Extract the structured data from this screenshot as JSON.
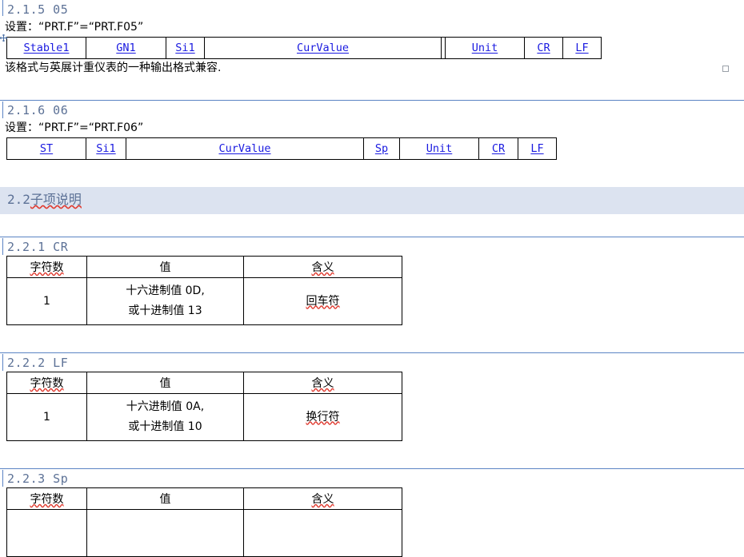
{
  "document": {
    "sections": [
      {
        "id": "2.1.5",
        "heading": "2.1.5 05",
        "setting_text": "设置：“PRT.F”=“PRT.F05”",
        "note": "该格式与英展计重仪表的一种输出格式兼容.",
        "format_fields": [
          "Stable1",
          "GN1",
          "Si1",
          "CurValue",
          "",
          "Unit",
          "CR",
          "LF"
        ]
      },
      {
        "id": "2.1.6",
        "heading": "2.1.6 06",
        "setting_text": "设置：“PRT.F”=“PRT.F06”",
        "format_fields": [
          "ST",
          "Si1",
          "CurValue",
          "Sp",
          "Unit",
          "CR",
          "LF"
        ]
      }
    ],
    "section_2_2": {
      "heading_number": "2.2",
      "heading_text": "子项说明",
      "items": [
        {
          "id": "2.2.1",
          "heading": "2.2.1 CR",
          "columns": [
            "字符数",
            "值",
            "含义"
          ],
          "row": {
            "count": "1",
            "value_line1": "十六进制值 0D,",
            "value_line2": "或十进制值 13",
            "meaning": "回车符"
          }
        },
        {
          "id": "2.2.2",
          "heading": "2.2.2 LF",
          "columns": [
            "字符数",
            "值",
            "含义"
          ],
          "row": {
            "count": "1",
            "value_line1": "十六进制值 0A,",
            "value_line2": "或十进制值 10",
            "meaning": "换行符"
          }
        },
        {
          "id": "2.2.3",
          "heading": "2.2.3 Sp",
          "columns": [
            "字符数",
            "值",
            "含义"
          ],
          "row": {
            "count": "",
            "value_line1": "",
            "value_line2": "",
            "meaning": ""
          }
        }
      ]
    },
    "colors": {
      "heading_text": "#5c7196",
      "heading_rule": "#5b84c4",
      "heading_band": "#dce3f0",
      "link_text": "#1a1ae0",
      "spell_error": "#e03a2f",
      "table_border": "#000000"
    }
  }
}
